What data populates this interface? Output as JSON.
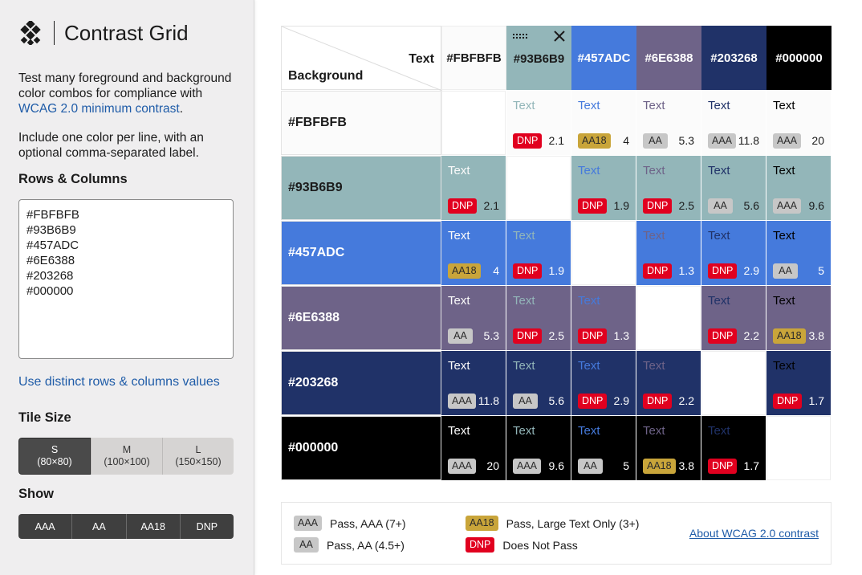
{
  "sidebar": {
    "title": "Contrast Grid",
    "intro_text": "Test many foreground and background color combos for compliance with ",
    "intro_link": "WCAG 2.0 minimum contrast",
    "intro_end": ".",
    "intro2": "Include one color per line, with an optional comma-separated label.",
    "rows_columns_label": "Rows & Columns",
    "color_lines": [
      "#FBFBFB",
      "#93B6B9",
      "#457ADC",
      "#6E6388",
      "#203268",
      "#000000"
    ],
    "distinct_link": "Use distinct rows & columns values",
    "tile_size_label": "Tile Size",
    "tile_sizes": [
      {
        "label": "S",
        "dims": "(80×80)"
      },
      {
        "label": "M",
        "dims": "(100×100)"
      },
      {
        "label": "L",
        "dims": "(150×150)"
      }
    ],
    "show_label": "Show",
    "show_options": [
      "AAA",
      "AA",
      "AA18",
      "DNP"
    ]
  },
  "grid": {
    "corner_text": "Text",
    "corner_background": "Background",
    "colors": [
      "#FBFBFB",
      "#93B6B9",
      "#457ADC",
      "#6E6388",
      "#203268",
      "#000000"
    ],
    "header_text_colors": [
      "#1b1b1b",
      "#1b1b1b",
      "#ffffff",
      "#ffffff",
      "#ffffff",
      "#ffffff"
    ],
    "sample_text": "Text",
    "combos": [
      [
        null,
        {
          "badge": "DNP",
          "ratio": "2.1"
        },
        {
          "badge": "AA18",
          "ratio": "4"
        },
        {
          "badge": "AA",
          "ratio": "5.3"
        },
        {
          "badge": "AAA",
          "ratio": "11.8"
        },
        {
          "badge": "AAA",
          "ratio": "20"
        }
      ],
      [
        {
          "badge": "DNP",
          "ratio": "2.1"
        },
        null,
        {
          "badge": "DNP",
          "ratio": "1.9"
        },
        {
          "badge": "DNP",
          "ratio": "2.5"
        },
        {
          "badge": "AA",
          "ratio": "5.6"
        },
        {
          "badge": "AAA",
          "ratio": "9.6"
        }
      ],
      [
        {
          "badge": "AA18",
          "ratio": "4"
        },
        {
          "badge": "DNP",
          "ratio": "1.9"
        },
        null,
        {
          "badge": "DNP",
          "ratio": "1.3"
        },
        {
          "badge": "DNP",
          "ratio": "2.9"
        },
        {
          "badge": "AA",
          "ratio": "5"
        }
      ],
      [
        {
          "badge": "AA",
          "ratio": "5.3"
        },
        {
          "badge": "DNP",
          "ratio": "2.5"
        },
        {
          "badge": "DNP",
          "ratio": "1.3"
        },
        null,
        {
          "badge": "DNP",
          "ratio": "2.2"
        },
        {
          "badge": "AA18",
          "ratio": "3.8"
        }
      ],
      [
        {
          "badge": "AAA",
          "ratio": "11.8"
        },
        {
          "badge": "AA",
          "ratio": "5.6"
        },
        {
          "badge": "DNP",
          "ratio": "2.9"
        },
        {
          "badge": "DNP",
          "ratio": "2.2"
        },
        null,
        {
          "badge": "DNP",
          "ratio": "1.7"
        }
      ],
      [
        {
          "badge": "AAA",
          "ratio": "20"
        },
        {
          "badge": "AAA",
          "ratio": "9.6"
        },
        {
          "badge": "AA",
          "ratio": "5"
        },
        {
          "badge": "AA18",
          "ratio": "3.8"
        },
        {
          "badge": "DNP",
          "ratio": "1.7"
        },
        null
      ]
    ]
  },
  "legend": {
    "items": [
      {
        "badge": "AAA",
        "text": "Pass, AAA (7+)"
      },
      {
        "badge": "AA",
        "text": "Pass, AA (4.5+)"
      },
      {
        "badge": "AA18",
        "text": "Pass, Large Text Only (3+)"
      },
      {
        "badge": "DNP",
        "text": "Does Not Pass"
      }
    ],
    "about_link": "About WCAG 2.0 contrast"
  }
}
